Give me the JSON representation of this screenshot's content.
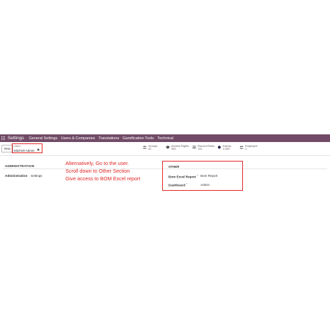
{
  "navbar": {
    "brand": "Settings",
    "menu": [
      "General Settings",
      "Users & Companies",
      "Translations",
      "Gamification Tools",
      "Technical"
    ],
    "color": "#714B67"
  },
  "controlbar": {
    "new_label": "New",
    "breadcrumb_parent": "Users",
    "breadcrumb_current": "Mitchell Admin"
  },
  "stats": [
    {
      "label": "Groups",
      "value": "42",
      "icon": "users-icon"
    },
    {
      "label": "Access Rights",
      "value": "382",
      "icon": "shield-icon"
    },
    {
      "label": "Record Rules",
      "value": "121",
      "icon": "rules-icon"
    },
    {
      "label": "Karma",
      "value": "2,550",
      "icon": "karma-icon"
    },
    {
      "label": "Employee",
      "value": "1",
      "icon": "employee-icon"
    }
  ],
  "section": {
    "title": "ADMINISTRATION",
    "admin_label": "Administration",
    "admin_value": "Settings"
  },
  "annotation": {
    "lines": [
      "Alternatively, Go to the user.",
      "Scroll down to Other Section",
      "Give access to BOM Excel report"
    ],
    "color": "#e32424"
  },
  "other": {
    "title": "OTHER",
    "fields": [
      {
        "label": "Bom Excel Report",
        "value": "Bom Report"
      },
      {
        "label": "Dashboard",
        "value": "Admin"
      }
    ],
    "help_marker": "?"
  }
}
